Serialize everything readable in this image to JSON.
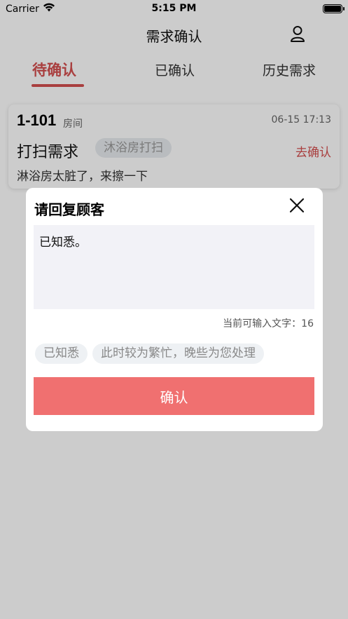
{
  "status_bar": {
    "carrier": "Carrier",
    "time": "5:15 PM",
    "icons": [
      "wifi-icon",
      "battery-icon"
    ]
  },
  "nav": {
    "title": "需求确认",
    "user_icon": "user-icon"
  },
  "tabs": [
    {
      "label": "待确认",
      "active": true
    },
    {
      "label": "已确认",
      "active": false
    },
    {
      "label": "历史需求",
      "active": false
    }
  ],
  "colors": {
    "accent": "#d44f4f",
    "confirm_button": "#f07070",
    "tag_bg": "#e8ecef",
    "textarea_bg": "#f2f2f7"
  },
  "card": {
    "room_number": "1-101",
    "room_suffix": "房间",
    "timestamp": "06-15 17:13",
    "request_type": "打扫需求",
    "tag": "沐浴房打扫",
    "action_label": "去确认",
    "description": "淋浴房太脏了，来擦一下"
  },
  "modal": {
    "title": "请回复顾客",
    "close_icon": "close-icon",
    "reply_text": "已知悉。",
    "counter_label": "当前可输入文字：",
    "counter_value": "16",
    "quick_replies": [
      "已知悉",
      "此时较为繁忙，晚些为您处理"
    ],
    "confirm_label": "确认"
  }
}
